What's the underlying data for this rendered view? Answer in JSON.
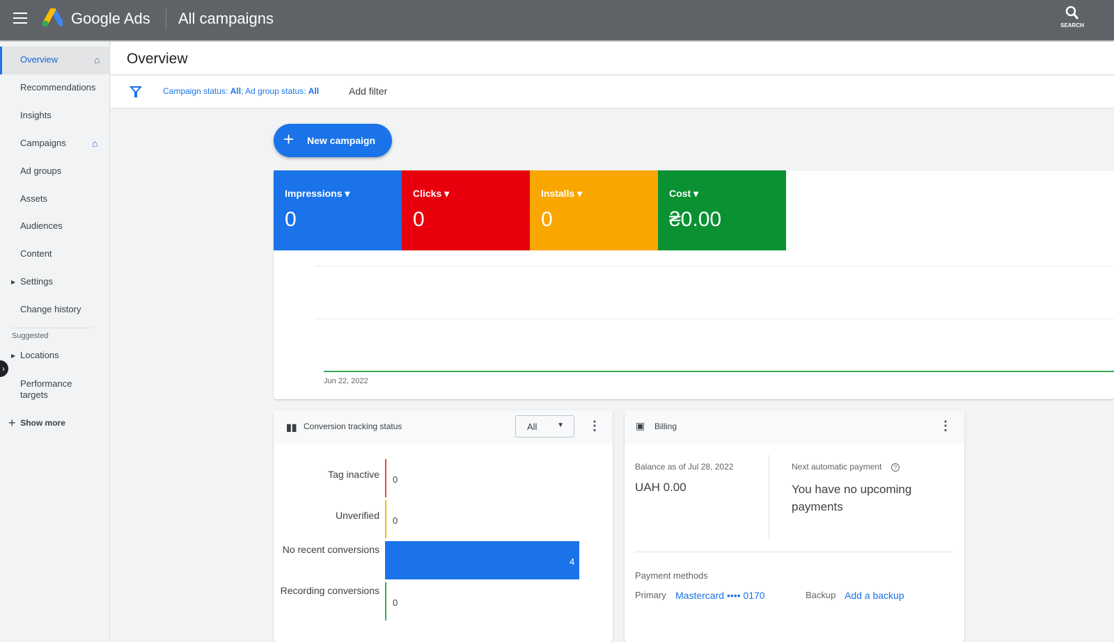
{
  "topbar": {
    "brand": "Google Ads",
    "title": "All campaigns",
    "search_label": "SEARCH"
  },
  "sidebar": {
    "items": [
      {
        "label": "Overview",
        "active": true
      },
      {
        "label": "Recommendations"
      },
      {
        "label": "Insights"
      },
      {
        "label": "Campaigns"
      },
      {
        "label": "Ad groups"
      },
      {
        "label": "Assets"
      },
      {
        "label": "Audiences"
      },
      {
        "label": "Content"
      },
      {
        "label": "Settings"
      },
      {
        "label": "Change history"
      }
    ],
    "suggested_label": "Suggested",
    "suggested": [
      {
        "label": "Locations"
      },
      {
        "label": "Performance targets"
      }
    ],
    "show_more": "Show more"
  },
  "header": {
    "title": "Overview"
  },
  "filter": {
    "campaign_status_label": "Campaign status: ",
    "campaign_status_value": "All",
    "ad_group_status_label": "; Ad group status: ",
    "ad_group_status_value": "All",
    "add_filter": "Add filter"
  },
  "new_campaign": "New campaign",
  "metrics": [
    {
      "label": "Impressions",
      "value": "0",
      "color": "#1a73e8"
    },
    {
      "label": "Clicks",
      "value": "0",
      "color": "#e8000d"
    },
    {
      "label": "Installs",
      "value": "0",
      "color": "#f9a600"
    },
    {
      "label": "Cost",
      "value": "₴0.00",
      "color": "#0a9132"
    }
  ],
  "chart": {
    "x_label": "Jun 22, 2022"
  },
  "conversion": {
    "title": "Conversion tracking status",
    "filter_value": "All",
    "rows": [
      {
        "label": "Tag inactive",
        "value": "0",
        "color": "#ea4335"
      },
      {
        "label": "Unverified",
        "value": "0",
        "color": "#fbbc04"
      },
      {
        "label": "No recent conversions",
        "value": "4",
        "color": "#1a73e8"
      },
      {
        "label": "Recording conversions",
        "value": "0",
        "color": "#34a853"
      }
    ]
  },
  "billing": {
    "title": "Billing",
    "balance_label": "Balance as of Jul 28, 2022",
    "balance": "UAH 0.00",
    "next_label": "Next automatic payment",
    "next_value": "You have no upcoming payments",
    "methods_label": "Payment methods",
    "primary_label": "Primary",
    "primary_value": "Mastercard •••• 0170",
    "backup_label": "Backup",
    "backup_value": "Add a backup"
  }
}
